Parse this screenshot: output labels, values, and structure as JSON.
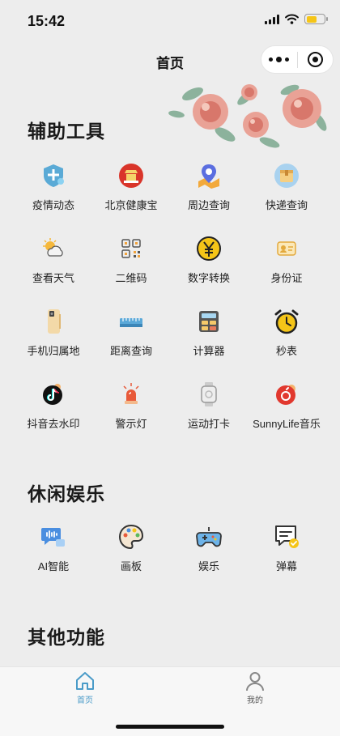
{
  "status": {
    "time": "15:42"
  },
  "nav": {
    "title": "首页",
    "more_icon": "more-dots-icon",
    "close_icon": "target-icon"
  },
  "colors": {
    "accent": "#4a9bc8",
    "background": "#ededed"
  },
  "sections": {
    "tools": {
      "title": "辅助工具",
      "items": [
        {
          "label": "疫情动态",
          "icon": "shield-virus-icon"
        },
        {
          "label": "北京健康宝",
          "icon": "health-code-icon"
        },
        {
          "label": "周边查询",
          "icon": "map-pin-icon"
        },
        {
          "label": "快递查询",
          "icon": "package-icon"
        },
        {
          "label": "查看天气",
          "icon": "weather-icon"
        },
        {
          "label": "二维码",
          "icon": "qrcode-icon"
        },
        {
          "label": "数字转换",
          "icon": "yuan-coin-icon"
        },
        {
          "label": "身份证",
          "icon": "id-card-icon"
        },
        {
          "label": "手机归属地",
          "icon": "phone-icon"
        },
        {
          "label": "距离查询",
          "icon": "ruler-icon"
        },
        {
          "label": "计算器",
          "icon": "calculator-icon"
        },
        {
          "label": "秒表",
          "icon": "alarm-clock-icon"
        },
        {
          "label": "抖音去水印",
          "icon": "tiktok-icon"
        },
        {
          "label": "警示灯",
          "icon": "siren-icon"
        },
        {
          "label": "运动打卡",
          "icon": "smartwatch-icon"
        },
        {
          "label": "SunnyLife音乐",
          "icon": "netease-music-icon"
        }
      ]
    },
    "leisure": {
      "title": "休闲娱乐",
      "items": [
        {
          "label": "AI智能",
          "icon": "ai-voice-icon"
        },
        {
          "label": "画板",
          "icon": "palette-icon"
        },
        {
          "label": "娱乐",
          "icon": "gamepad-icon"
        },
        {
          "label": "弹幕",
          "icon": "danmaku-icon"
        }
      ]
    },
    "other": {
      "title": "其他功能"
    }
  },
  "tabbar": {
    "items": [
      {
        "label": "首页",
        "icon": "home-icon",
        "active": true
      },
      {
        "label": "我的",
        "icon": "user-icon",
        "active": false
      }
    ]
  }
}
